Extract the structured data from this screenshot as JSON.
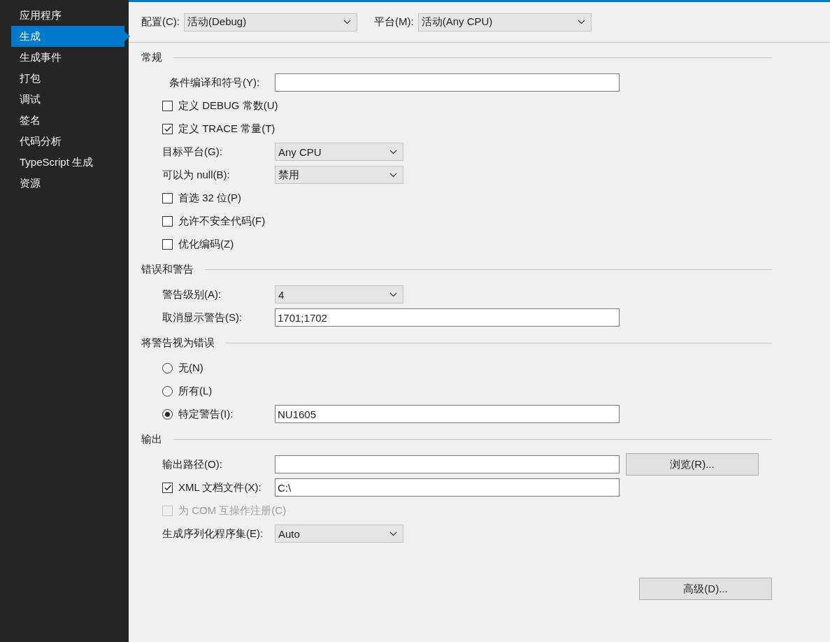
{
  "sidebar": {
    "items": [
      {
        "label": "应用程序",
        "selected": false
      },
      {
        "label": "生成",
        "selected": true
      },
      {
        "label": "生成事件",
        "selected": false
      },
      {
        "label": "打包",
        "selected": false
      },
      {
        "label": "调试",
        "selected": false
      },
      {
        "label": "签名",
        "selected": false
      },
      {
        "label": "代码分析",
        "selected": false
      },
      {
        "label": "TypeScript 生成",
        "selected": false
      },
      {
        "label": "资源",
        "selected": false
      }
    ]
  },
  "toolbar": [
    {
      "label": "配置(C):",
      "value": "活动(Debug)"
    },
    {
      "label": "平台(M):",
      "value": "活动(Any CPU)"
    }
  ],
  "sections": [
    {
      "title": "常规",
      "rows": [
        {
          "kind": "text",
          "label": "条件编译和符号(Y):",
          "indent": true
        },
        {
          "kind": "check",
          "label": "定义 DEBUG 常数(U)",
          "checked": false,
          "disabled": false
        },
        {
          "kind": "check",
          "label": "定义 TRACE 常量(T)",
          "checked": true,
          "disabled": false
        },
        {
          "kind": "select",
          "label": "目标平台(G):",
          "value": "Any CPU"
        },
        {
          "kind": "select",
          "label": "可以为 null(B):",
          "value": "禁用"
        },
        {
          "kind": "check",
          "label": "首选 32 位(P)",
          "checked": false,
          "disabled": false
        },
        {
          "kind": "check",
          "label": "允许不安全代码(F)",
          "checked": false,
          "disabled": false
        },
        {
          "kind": "check",
          "label": "优化编码(Z)",
          "checked": false,
          "disabled": false
        }
      ]
    },
    {
      "title": "错误和警告",
      "rows": [
        {
          "kind": "select",
          "label": "警告级别(A):",
          "value": "4"
        },
        {
          "kind": "text",
          "label": "取消显示警告(S):",
          "value": "1701;1702"
        }
      ]
    },
    {
      "title": "将警告视为错误",
      "rows": [
        {
          "kind": "radio",
          "label": "无(N)",
          "selected": false
        },
        {
          "kind": "radio",
          "label": "所有(L)",
          "selected": false
        },
        {
          "kind": "radio",
          "label": "特定警告(I):",
          "selected": true,
          "value": "NU1605"
        }
      ]
    },
    {
      "title": "输出",
      "rows": [
        {
          "kind": "text",
          "label": "输出路径(O):",
          "button": "浏览(R)..."
        },
        {
          "kind": "check",
          "label": "XML 文档文件(X):",
          "checked": true,
          "disabled": false,
          "value": "C:\\"
        },
        {
          "kind": "check",
          "label": "为 COM 互操作注册(C)",
          "checked": false,
          "disabled": true
        },
        {
          "kind": "select",
          "label": "生成序列化程序集(E):",
          "value": "Auto"
        }
      ]
    }
  ],
  "advanced_button": "高级(D)..."
}
